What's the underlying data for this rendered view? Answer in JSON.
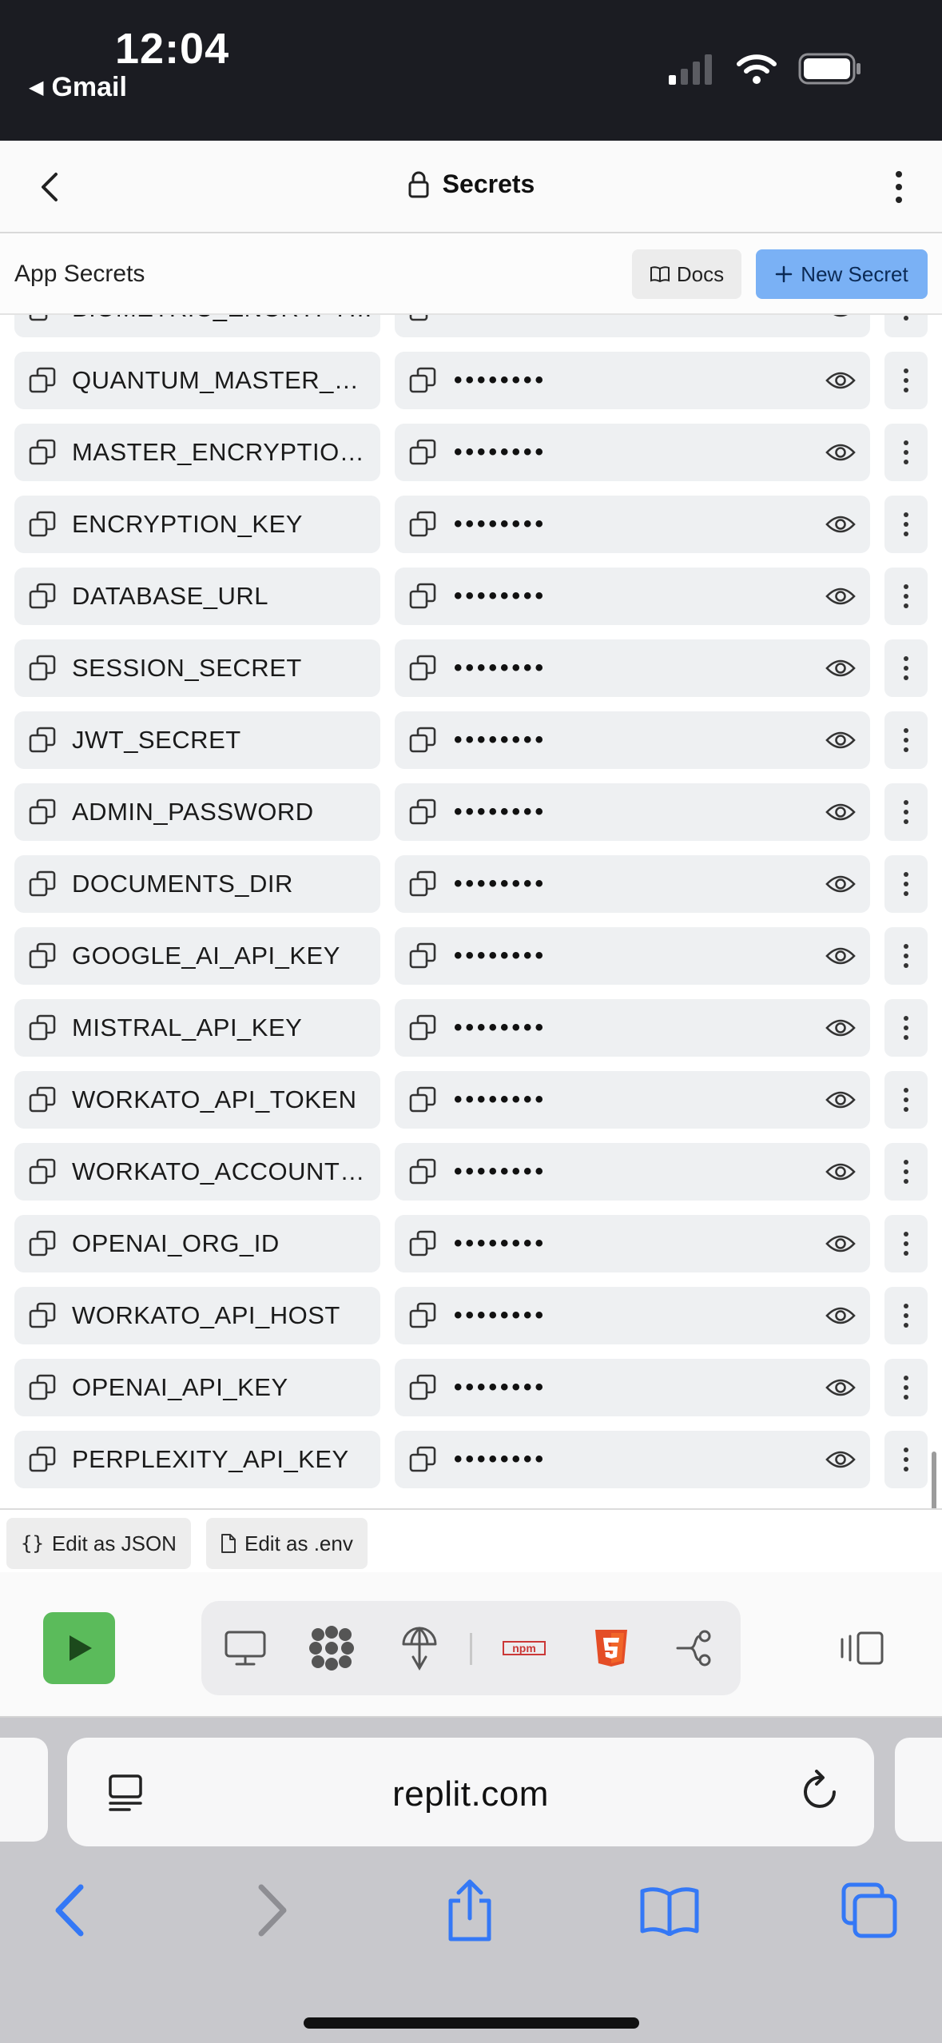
{
  "status_bar": {
    "time": "12:04",
    "back_app": "Gmail"
  },
  "header": {
    "title": "Secrets"
  },
  "toolbar": {
    "title": "App Secrets",
    "docs_label": "Docs",
    "new_secret_label": "New Secret"
  },
  "secrets": [
    {
      "key": "BIOMETRIC_ENCRYPTI...",
      "value": "••••••••"
    },
    {
      "key": "QUANTUM_MASTER_KEY",
      "value": "••••••••"
    },
    {
      "key": "MASTER_ENCRYPTION_...",
      "value": "••••••••"
    },
    {
      "key": "ENCRYPTION_KEY",
      "value": "••••••••"
    },
    {
      "key": "DATABASE_URL",
      "value": "••••••••"
    },
    {
      "key": "SESSION_SECRET",
      "value": "••••••••"
    },
    {
      "key": "JWT_SECRET",
      "value": "••••••••"
    },
    {
      "key": "ADMIN_PASSWORD",
      "value": "••••••••"
    },
    {
      "key": "DOCUMENTS_DIR",
      "value": "••••••••"
    },
    {
      "key": "GOOGLE_AI_API_KEY",
      "value": "••••••••"
    },
    {
      "key": "MISTRAL_API_KEY",
      "value": "••••••••"
    },
    {
      "key": "WORKATO_API_TOKEN",
      "value": "••••••••"
    },
    {
      "key": "WORKATO_ACCOUNT_ID",
      "value": "••••••••"
    },
    {
      "key": "OPENAI_ORG_ID",
      "value": "••••••••"
    },
    {
      "key": "WORKATO_API_HOST",
      "value": "••••••••"
    },
    {
      "key": "OPENAI_API_KEY",
      "value": "••••••••"
    },
    {
      "key": "PERPLEXITY_API_KEY",
      "value": "••••••••"
    }
  ],
  "footer": {
    "edit_json_label": "Edit as JSON",
    "edit_env_label": "Edit as .env"
  },
  "workspace_tools": [
    "run-icon",
    "monitor-icon",
    "packages-icon",
    "deploy-icon",
    "npm-icon",
    "html5-icon",
    "git-icon",
    "split-view-icon"
  ],
  "browser": {
    "url": "replit.com"
  },
  "colors": {
    "accent": "#7ab1f5",
    "run": "#5bbb5b",
    "safari_blue": "#3478f6",
    "npm_red": "#cb3837",
    "html5_orange": "#e44d26"
  }
}
